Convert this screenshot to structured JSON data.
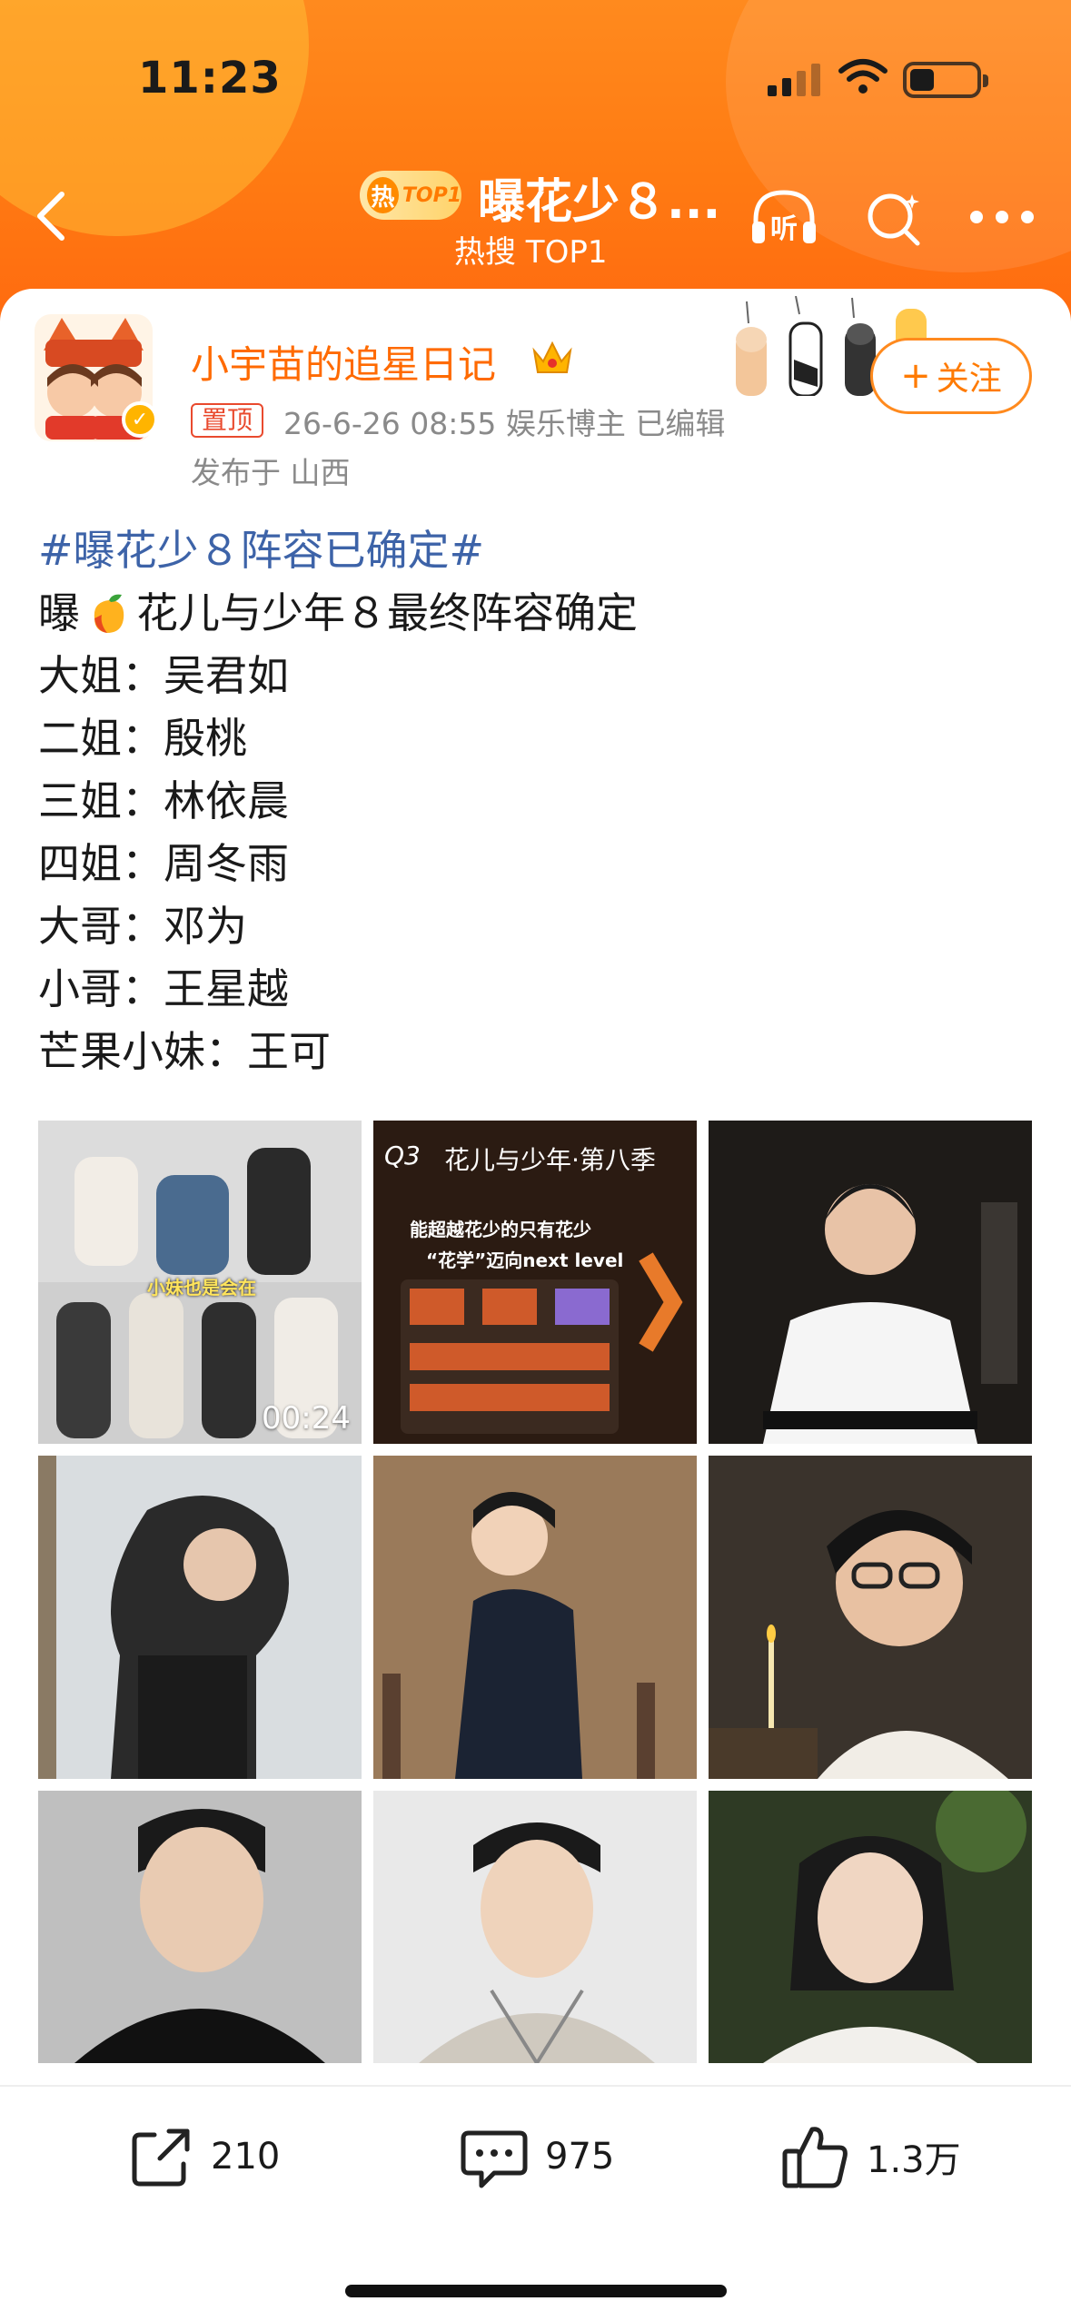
{
  "status_bar": {
    "time": "11:23"
  },
  "nav": {
    "hot_badge_char": "热",
    "hot_badge_label": "TOP1",
    "title": "曝花少８...",
    "subtitle": "热搜 TOP1",
    "listen_label": "听"
  },
  "post": {
    "author": "小宇苗的追星日记",
    "pinned_label": "置顶",
    "meta": "26-6-26 08:55  娱乐博主  已编辑",
    "location": "发布于 山西",
    "follow_label": "关注",
    "topic": "#曝花少８阵容已确定#",
    "line1_prefix": "曝",
    "line1_suffix": "花儿与少年８最终阵容确定",
    "lines": [
      "大姐：吴君如",
      "二姐：殷桃",
      "三姐：林依晨",
      "四姐：周冬雨",
      "大哥：邓为",
      "小哥：王星越",
      "芒果小妹：王可"
    ]
  },
  "images": {
    "video_duration": "00:24",
    "video_caption": "小妹也是会在",
    "promo_q3": "Q3",
    "promo_title": "花儿与少年·第八季",
    "promo_line1": "能超越花少的只有花少",
    "promo_line2": "“花学”迈向next level"
  },
  "toolbar": {
    "share_count": "210",
    "comment_count": "975",
    "like_count": "1.3万"
  },
  "colors": {
    "header_orange": "#ff7a12",
    "accent": "#ff6a00",
    "topic_blue": "#3d63a8"
  }
}
